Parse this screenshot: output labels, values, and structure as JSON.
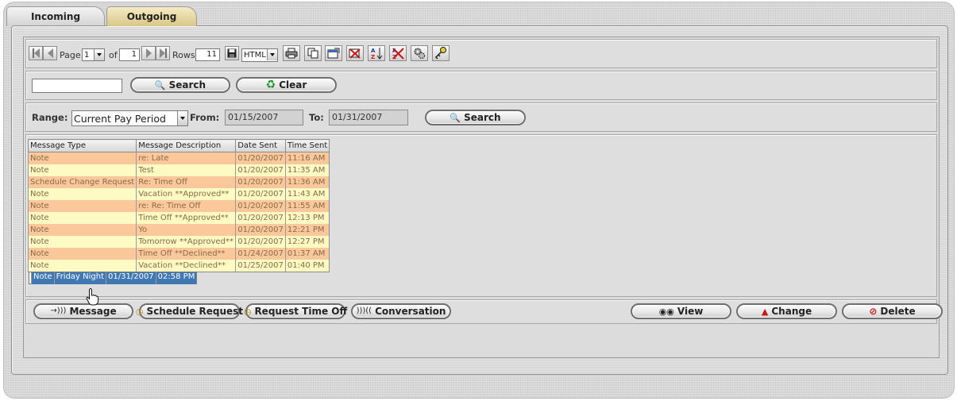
{
  "tabs": [
    {
      "label": "Incoming",
      "active": false
    },
    {
      "label": "Outgoing",
      "active": true
    }
  ],
  "toolbar": {
    "page_label": "Page",
    "page_value": "1",
    "of_label": "of",
    "total_pages": "1",
    "rows_label": "Rows",
    "rows_value": "11",
    "export_format": "HTML",
    "icons": [
      "first-page-icon",
      "prev-page-icon",
      "next-page-icon",
      "last-page-icon",
      "save-icon",
      "print-icon",
      "copy-icon",
      "properties-icon",
      "clear-filter-icon",
      "sort-icon",
      "remove-sort-icon",
      "settings-gear-icon",
      "key-icon"
    ]
  },
  "search": {
    "input_value": "",
    "search_label": "Search",
    "clear_label": "Clear"
  },
  "range": {
    "range_label": "Range:",
    "range_value": "Current Pay Period",
    "from_label": "From:",
    "from_value": "01/15/2007",
    "to_label": "To:",
    "to_value": "01/31/2007",
    "search_label": "Search"
  },
  "grid": {
    "columns": [
      "Message Type",
      "Message Description",
      "Date Sent",
      "Time Sent"
    ],
    "rows": [
      {
        "type": "Note",
        "desc": "re: Late",
        "date": "01/20/2007",
        "time": "11:16 AM"
      },
      {
        "type": "Note",
        "desc": "Test",
        "date": "01/20/2007",
        "time": "11:35 AM"
      },
      {
        "type": "Schedule Change Request",
        "desc": "Re: Time Off",
        "date": "01/20/2007",
        "time": "11:36 AM"
      },
      {
        "type": "Note",
        "desc": "Vacation **Approved**",
        "date": "01/20/2007",
        "time": "11:43 AM"
      },
      {
        "type": "Note",
        "desc": "re: Re: Time Off",
        "date": "01/20/2007",
        "time": "11:55 AM"
      },
      {
        "type": "Note",
        "desc": "Time Off **Approved**",
        "date": "01/20/2007",
        "time": "12:13 PM"
      },
      {
        "type": "Note",
        "desc": "Yo",
        "date": "01/20/2007",
        "time": "12:21 PM"
      },
      {
        "type": "Note",
        "desc": "Tomorrow **Approved**",
        "date": "01/20/2007",
        "time": "12:27 PM"
      },
      {
        "type": "Note",
        "desc": "Time Off **Declined**",
        "date": "01/24/2007",
        "time": "01:37 AM"
      },
      {
        "type": "Note",
        "desc": "Vacation **Declined**",
        "date": "01/25/2007",
        "time": "01:40 PM"
      },
      {
        "type": "Note",
        "desc": "Friday Night",
        "date": "01/31/2007",
        "time": "02:58 PM"
      }
    ],
    "selected_row": 10
  },
  "actions": {
    "message": "Message",
    "schedule_request": "Schedule Request",
    "request_time_off": "Request Time Off",
    "conversation": "Conversation",
    "view": "View",
    "change": "Change",
    "delete": "Delete"
  },
  "colors": {
    "odd_row": "#fac89a",
    "even_row": "#fdfbc3",
    "selected_row": "#3f78b3",
    "active_tab": "#e2d29a"
  }
}
